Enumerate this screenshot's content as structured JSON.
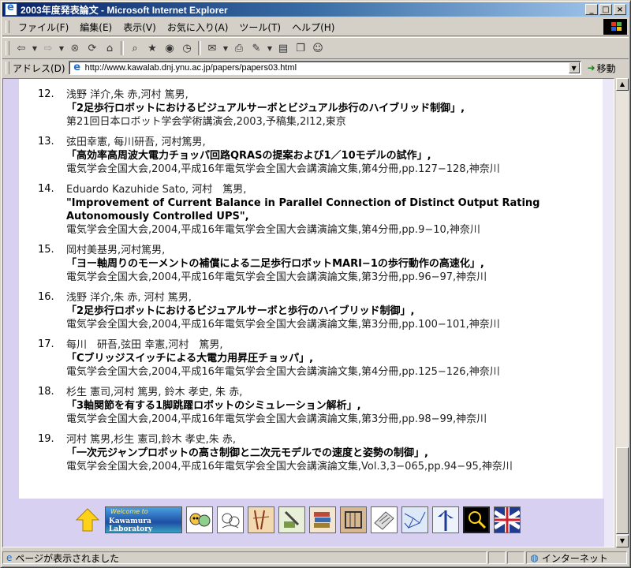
{
  "window": {
    "title": "2003年度発表論文 - Microsoft Internet Explorer"
  },
  "menu": [
    "ファイル(F)",
    "編集(E)",
    "表示(V)",
    "お気に入り(A)",
    "ツール(T)",
    "ヘルプ(H)"
  ],
  "address": {
    "label": "アドレス(D)",
    "url": "http://www.kawalab.dnj.ynu.ac.jp/papers/papers03.html",
    "go": "移動"
  },
  "entries": [
    {
      "num": "12.",
      "authors": "浅野 洋介,朱 赤,河村 篤男,",
      "title": "「2足歩行ロボットにおけるビジュアルサーボとビジュアル歩行のハイブリッド制御」,",
      "venue": "第21回日本ロボット学会学術講演会,2003,予稿集,2I12,東京"
    },
    {
      "num": "13.",
      "authors": "弦田幸憲, 每川研吾, 河村篤男,",
      "title": "「高効率高周波大電力チョッパ回路QRASの提案および1／10モデルの試作」,",
      "venue": "電気学会全国大会,2004,平成16年電気学会全国大会講演論文集,第4分冊,pp.127−128,神奈川"
    },
    {
      "num": "14.",
      "authors": "Eduardo Kazuhide Sato, 河村　篤男,",
      "title": "\"Improvement of Current Balance in Parallel Connection of Distinct Output Rating Autonomously Controlled UPS\",",
      "venue": "電気学会全国大会,2004,平成16年電気学会全国大会講演論文集,第4分冊,pp.9−10,神奈川"
    },
    {
      "num": "15.",
      "authors": "岡村美基男,河村篤男,",
      "title": "「ヨー軸周りのモーメントの補償による二足歩行ロボットMARI−1の歩行動作の高速化」,",
      "venue": "電気学会全国大会,2004,平成16年電気学会全国大会講演論文集,第3分冊,pp.96−97,神奈川"
    },
    {
      "num": "16.",
      "authors": "浅野 洋介,朱 赤, 河村 篤男,",
      "title": "「2足歩行ロボットにおけるビジュアルサーボと歩行のハイブリッド制御」,",
      "venue": "電気学会全国大会,2004,平成16年電気学会全国大会講演論文集,第3分冊,pp.100−101,神奈川"
    },
    {
      "num": "17.",
      "authors": "每川　研吾,弦田 幸憲,河村　篤男,",
      "title": "「Cブリッジスイッチによる大電力用昇圧チョッパ」,",
      "venue": "電気学会全国大会,2004,平成16年電気学会全国大会講演論文集,第4分冊,pp.125−126,神奈川"
    },
    {
      "num": "18.",
      "authors": "杉生 憲司,河村 篤男, 鈴木 孝史, 朱 赤,",
      "title": "「3軸関節を有する1脚跳躍ロボットのシミュレーション解析」,",
      "venue": "電気学会全国大会,2004,平成16年電気学会全国大会講演論文集,第3分冊,pp.98−99,神奈川"
    },
    {
      "num": "19.",
      "authors": "河村 篤男,杉生 憲司,鈴木 孝史,朱 赤,",
      "title": "「一次元ジャンプロボットの高さ制御と二次元モデルでの速度と姿勢の制御」,",
      "venue": "電気学会全国大会,2004,平成16年電気学会全国大会講演論文集,Vol.3,3−065,pp.94−95,神奈川"
    }
  ],
  "footer": {
    "logo_line1": "Welcome to",
    "logo_line2": "Kawamura Laboratory"
  },
  "status": {
    "text": "ページが表示されました",
    "zone": "インターネット"
  }
}
